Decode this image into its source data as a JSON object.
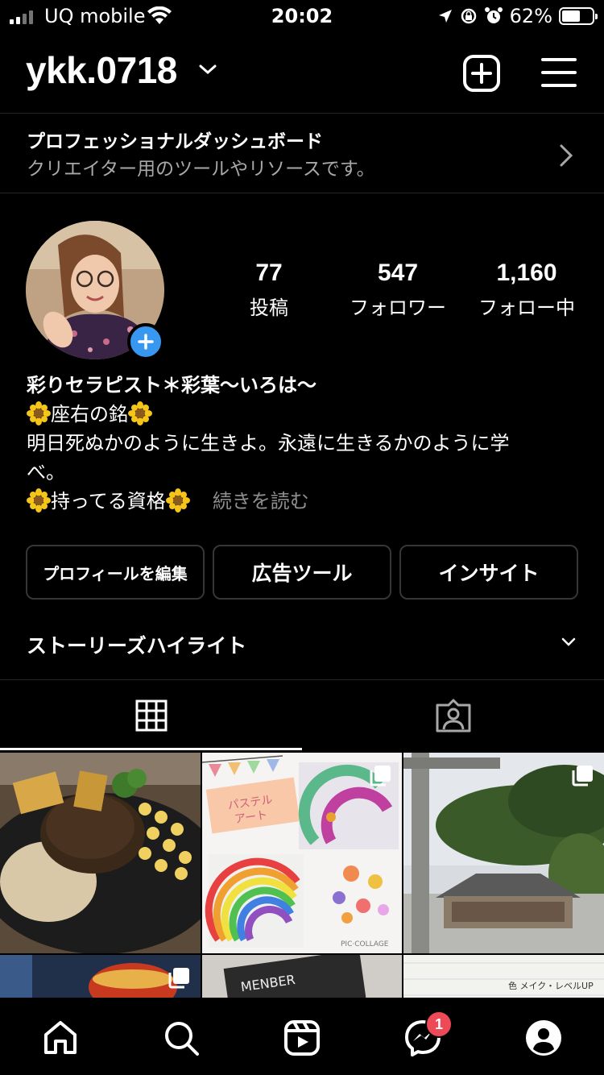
{
  "status_bar": {
    "carrier": "UQ mobile",
    "time": "20:02",
    "battery": "62%",
    "battery_level": 0.62
  },
  "header": {
    "username": "ykk.0718"
  },
  "pro_dashboard": {
    "title": "プロフェッショナルダッシュボード",
    "subtitle": "クリエイター用のツールやリソースです。"
  },
  "profile": {
    "stats": [
      {
        "value": "77",
        "label": "投稿"
      },
      {
        "value": "547",
        "label": "フォロワー"
      },
      {
        "value": "1,160",
        "label": "フォロー中"
      }
    ],
    "bio_name": "彩りセラピスト＊彩葉〜いろは〜",
    "bio_line1": "座右の銘",
    "bio_line2": "明日死ぬかのように生きよ。永遠に生きるかのように学",
    "bio_line3": "べ。",
    "bio_line4": "持ってる資格",
    "more": "続きを読む"
  },
  "actions": {
    "edit_profile": "プロフィールを編集",
    "ad_tools": "広告ツール",
    "insights": "インサイト"
  },
  "highlights": {
    "label": "ストーリーズハイライト"
  },
  "grid_text": {
    "pastel_label": "パステル\nアート",
    "collage_label": "PIC·COLLAGE",
    "menber_label": "MENBER",
    "note_label": "色 メイク・レベルUP"
  },
  "bottom_nav": {
    "messages_badge": "1"
  },
  "colors": {
    "accent_blue": "#3897f0",
    "badge_red": "#ed4956",
    "border": "#363636"
  }
}
